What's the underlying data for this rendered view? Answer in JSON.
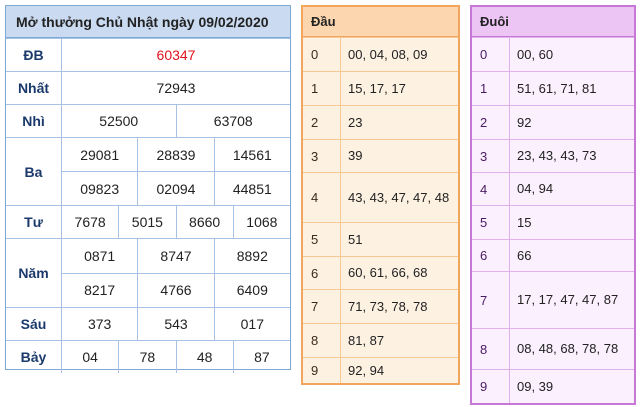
{
  "results": {
    "title": "Mở thưởng Chủ Nhật ngày 09/02/2020",
    "prizes": [
      {
        "name": "ĐB",
        "lines": [
          [
            "60347"
          ]
        ]
      },
      {
        "name": "Nhất",
        "lines": [
          [
            "72943"
          ]
        ]
      },
      {
        "name": "Nhì",
        "lines": [
          [
            "52500",
            "63708"
          ]
        ]
      },
      {
        "name": "Ba",
        "lines": [
          [
            "29081",
            "28839",
            "14561"
          ],
          [
            "09823",
            "02094",
            "44851"
          ]
        ]
      },
      {
        "name": "Tư",
        "lines": [
          [
            "7678",
            "5015",
            "8660",
            "1068"
          ]
        ]
      },
      {
        "name": "Năm",
        "lines": [
          [
            "0871",
            "8747",
            "8892"
          ],
          [
            "8217",
            "4766",
            "6409"
          ]
        ]
      },
      {
        "name": "Sáu",
        "lines": [
          [
            "373",
            "543",
            "017"
          ]
        ]
      },
      {
        "name": "Bảy",
        "lines": [
          [
            "04",
            "78",
            "48",
            "87"
          ]
        ]
      }
    ],
    "special_color": "#e0141e"
  },
  "dau": {
    "header": "Đầu",
    "rows": [
      {
        "idx": "0",
        "val": "00, 04, 08, 09"
      },
      {
        "idx": "1",
        "val": "15, 17, 17"
      },
      {
        "idx": "2",
        "val": "23"
      },
      {
        "idx": "3",
        "val": "39"
      },
      {
        "idx": "4",
        "val": "43, 43, 47, 47, 48"
      },
      {
        "idx": "5",
        "val": "51"
      },
      {
        "idx": "6",
        "val": "60, 61, 66, 68"
      },
      {
        "idx": "7",
        "val": "71, 73, 78, 78"
      },
      {
        "idx": "8",
        "val": "81, 87"
      },
      {
        "idx": "9",
        "val": "92, 94"
      }
    ]
  },
  "duoi": {
    "header": "Đuôi",
    "rows": [
      {
        "idx": "0",
        "val": "00, 60"
      },
      {
        "idx": "1",
        "val": "51, 61, 71, 81"
      },
      {
        "idx": "2",
        "val": "92"
      },
      {
        "idx": "3",
        "val": "23, 43, 43, 73"
      },
      {
        "idx": "4",
        "val": "04, 94"
      },
      {
        "idx": "5",
        "val": "15"
      },
      {
        "idx": "6",
        "val": "66"
      },
      {
        "idx": "7",
        "val": "17, 17, 47, 47, 87"
      },
      {
        "idx": "8",
        "val": "08, 48, 68, 78, 78"
      },
      {
        "idx": "9",
        "val": "09, 39"
      }
    ]
  }
}
